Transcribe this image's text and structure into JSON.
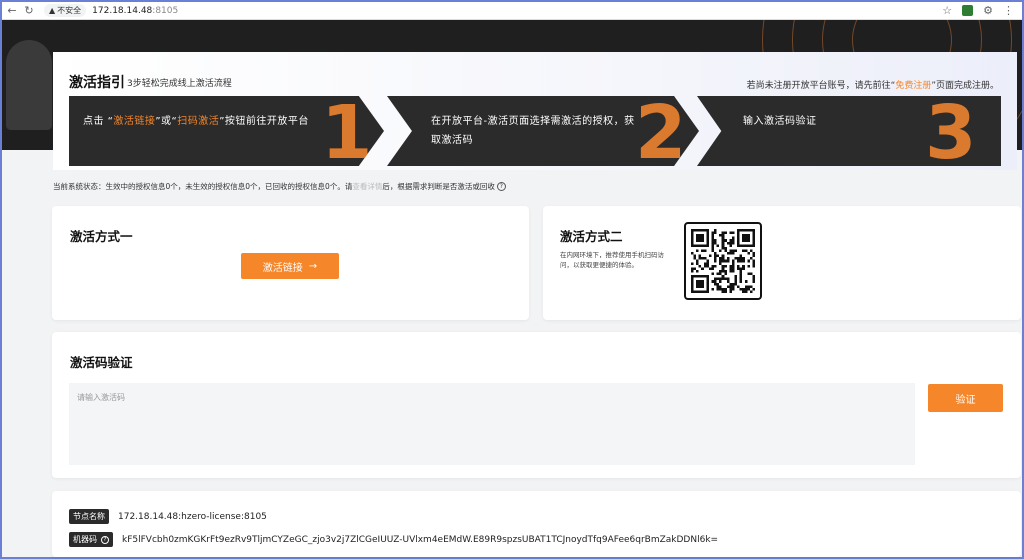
{
  "browser": {
    "insecure_label": "不安全",
    "url_host": "172.18.14.48",
    "url_port": ":8105"
  },
  "guide": {
    "title": "激活指引",
    "subtitle": "3步轻松完成线上激活流程",
    "note_prefix": "若尚未注册开放平台账号，请先前往“",
    "note_link": "免费注册",
    "note_suffix": "”页面完成注册。",
    "steps": [
      {
        "text_a": "点击 “",
        "hl1": "激活链接",
        "text_b": "”或“",
        "hl2": "扫码激活",
        "text_c": "”按钮前往开放平台",
        "number": "1"
      },
      {
        "text": "在开放平台-激活页面选择需激活的授权，获取激活码",
        "number": "2"
      },
      {
        "text": "输入激活码验证",
        "number": "3"
      }
    ]
  },
  "status": {
    "text_a": "当前系统状态：生效中的授权信息0个，未生效的授权信息0个，已回收的授权信息0个。请",
    "muted": "查看详情",
    "text_b": "后，根据需求判断是否激活或回收"
  },
  "method1": {
    "title": "激活方式一",
    "button_label": "激活链接"
  },
  "method2": {
    "title": "激活方式二",
    "description": "在内网环境下，推荐使用手机扫码访问，以获取更便捷的体验。"
  },
  "verify": {
    "title": "激活码验证",
    "placeholder": "请输入激活码",
    "button_label": "验证"
  },
  "info": {
    "node_label": "节点名称",
    "node_value": "172.18.14.48:hzero-license:8105",
    "machine_label": "机器码",
    "machine_value": "kF5lFVcbh0zmKGKrFt9ezRv9TljmCYZeGC_zjo3v2j7ZlCGeIUUZ-UVlxm4eEMdW.E89R9spzsUBAT1TCJnoydTfq9AFee6qrBmZakDDNl6k="
  },
  "colors": {
    "accent": "#f5862a",
    "dark": "#2b2b2b"
  }
}
